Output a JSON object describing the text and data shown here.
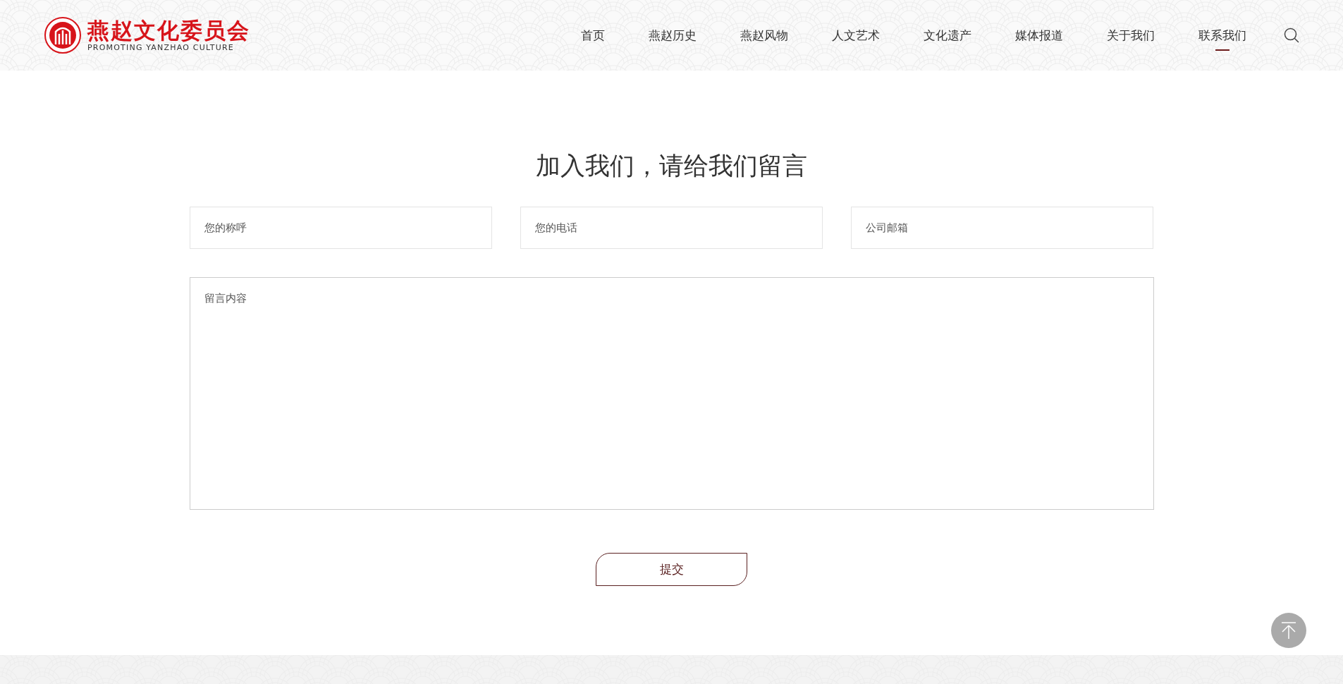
{
  "logo": {
    "title": "燕赵文化委员会",
    "subtitle": "PROMOTING YANZHAO CULTURE"
  },
  "nav": [
    {
      "label": "首页",
      "selected": false
    },
    {
      "label": "燕赵历史",
      "selected": false
    },
    {
      "label": "燕赵风物",
      "selected": false
    },
    {
      "label": "人文艺术",
      "selected": false
    },
    {
      "label": "文化遗产",
      "selected": false
    },
    {
      "label": "媒体报道",
      "selected": false
    },
    {
      "label": "关于我们",
      "selected": false
    },
    {
      "label": "联系我们",
      "selected": true
    }
  ],
  "form": {
    "title": "加入我们，请给我们留言",
    "fields": [
      {
        "placeholder": "您的称呼"
      },
      {
        "placeholder": "您的电话"
      },
      {
        "placeholder": "公司邮箱"
      }
    ],
    "message": {
      "placeholder": "留言内容"
    },
    "submit": "提交"
  }
}
